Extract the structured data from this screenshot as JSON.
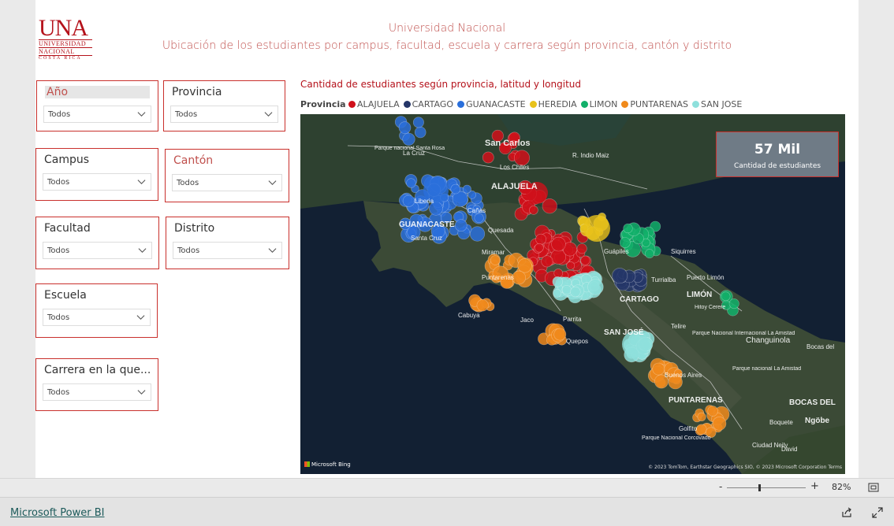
{
  "logo": {
    "main": "UNA",
    "line1": "UNIVERSIDAD",
    "line2": "NACIONAL",
    "line3": "COSTA RICA"
  },
  "header": {
    "title": "Universidad Nacional",
    "subtitle": "Ubicación de los estudiantes por campus, facultad, escuela y carrera según provincia, cantón y distrito"
  },
  "slicers": {
    "anio": {
      "label": "Año",
      "value": "Todos"
    },
    "provincia": {
      "label": "Provincia",
      "value": "Todos"
    },
    "campus": {
      "label": "Campus",
      "value": "Todos"
    },
    "canton": {
      "label": "Cantón",
      "value": "Todos"
    },
    "facultad": {
      "label": "Facultad",
      "value": "Todos"
    },
    "distrito": {
      "label": "Distrito",
      "value": "Todos"
    },
    "escuela": {
      "label": "Escuela",
      "value": "Todos"
    },
    "carrera": {
      "label": "Carrera en la que...",
      "value": "Todos"
    }
  },
  "map": {
    "title": "Cantidad de estudiantes según provincia, latitud y longitud",
    "legend_title": "Provincia",
    "legend": [
      {
        "name": "ALAJUELA",
        "color": "#d0101a"
      },
      {
        "name": "CARTAGO",
        "color": "#253668"
      },
      {
        "name": "GUANACASTE",
        "color": "#2a6fdb"
      },
      {
        "name": "HEREDIA",
        "color": "#e8c21a"
      },
      {
        "name": "LIMON",
        "color": "#12b06a"
      },
      {
        "name": "PUNTARENAS",
        "color": "#f08a1c"
      },
      {
        "name": "SAN JOSE",
        "color": "#8ee0dc"
      }
    ],
    "places": [
      "San Carlos",
      "Los Chiles",
      "La Cruz",
      "Parque nacional Santa Rosa",
      "R. Indio Maiz",
      "ALAJUELA",
      "Liberia",
      "Cañas",
      "GUANACASTE",
      "Santa Cruz",
      "Quesada",
      "Miramar",
      "Puntarenas",
      "Guápiles",
      "Siquirres",
      "Puerto Limón",
      "Turrialba",
      "CARTAGO",
      "LIMÓN",
      "Hitoy Cerere",
      "Cabuya",
      "Jaco",
      "Parrita",
      "Quepos",
      "SAN JOSÉ",
      "Telire",
      "Parque Nacional Internacional La Amistad",
      "Changuinola",
      "Bocas del",
      "Buenos Aires",
      "Parque nacional La Amistad",
      "PUNTARENAS",
      "BOCAS DEL",
      "Golfito",
      "Ngöbe",
      "Boquete",
      "Parque Nacional Corcovado",
      "Ciudad Neily",
      "David"
    ],
    "bing_label": "Microsoft Bing",
    "credit": "© 2023 TomTom, Earthstar Geographics SIO, © 2023 Microsoft Corporation  Terms"
  },
  "card": {
    "value": "57 Mil",
    "caption": "Cantidad de estudiantes"
  },
  "zoom": {
    "minus": "-",
    "plus": "+",
    "percent": "82%",
    "level": 0.4
  },
  "footer": {
    "brand": "Microsoft Power BI"
  },
  "icons": [
    "chevron-down-icon",
    "fit-page-icon",
    "share-icon",
    "fullscreen-icon"
  ]
}
